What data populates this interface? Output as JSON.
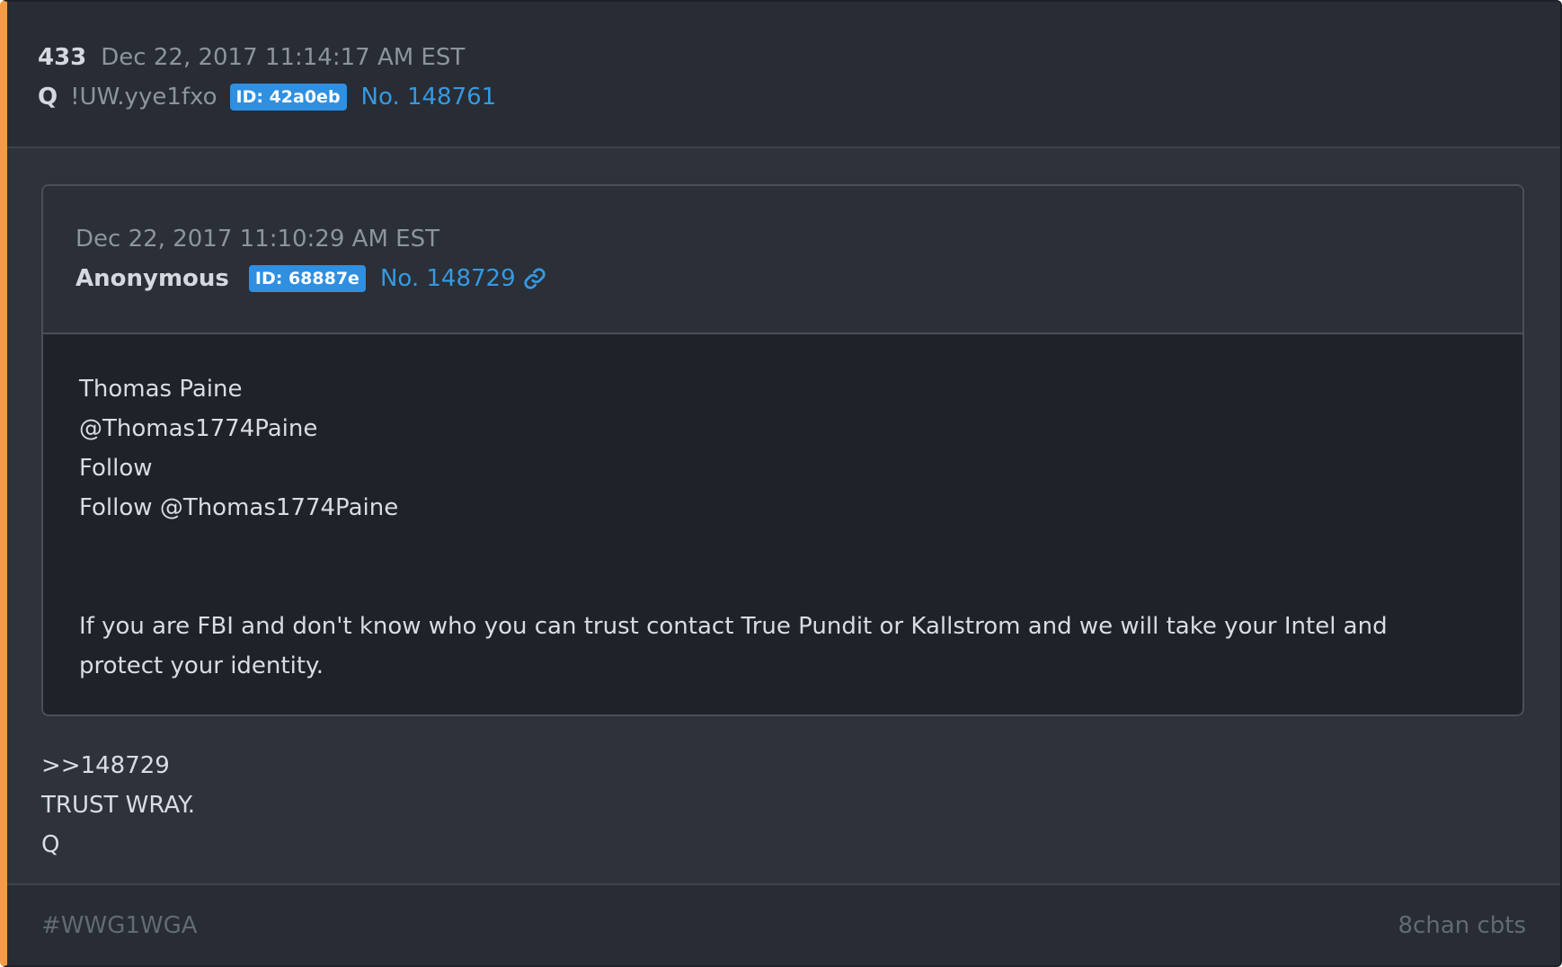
{
  "post": {
    "number": "433",
    "date": "Dec 22, 2017 11:14:17 AM EST",
    "author": "Q",
    "tripcode": "!UW.yye1fxo",
    "id_badge": "ID: 42a0eb",
    "post_link": "No. 148761"
  },
  "quoted_post": {
    "date": "Dec 22, 2017 11:10:29 AM EST",
    "author": "Anonymous",
    "id_badge": "ID: 68887e",
    "post_link": "No. 148729",
    "link_icon": "link-icon",
    "body_lines": [
      "Thomas Paine",
      "@Thomas1774Paine",
      "Follow",
      "Follow @Thomas1774Paine"
    ],
    "body_paragraph": "If you are FBI and don't know who you can trust contact True Pundit or Kallstrom and we will take your Intel and protect your identity."
  },
  "reply": {
    "lines": [
      ">>148729",
      "TRUST WRAY.",
      "Q"
    ]
  },
  "footer": {
    "hashtag": "#WWG1WGA",
    "source": "8chan cbts"
  },
  "colors": {
    "accent_border": "#f39c44",
    "id_badge": "#2f8fe0",
    "link": "#3599e2"
  }
}
